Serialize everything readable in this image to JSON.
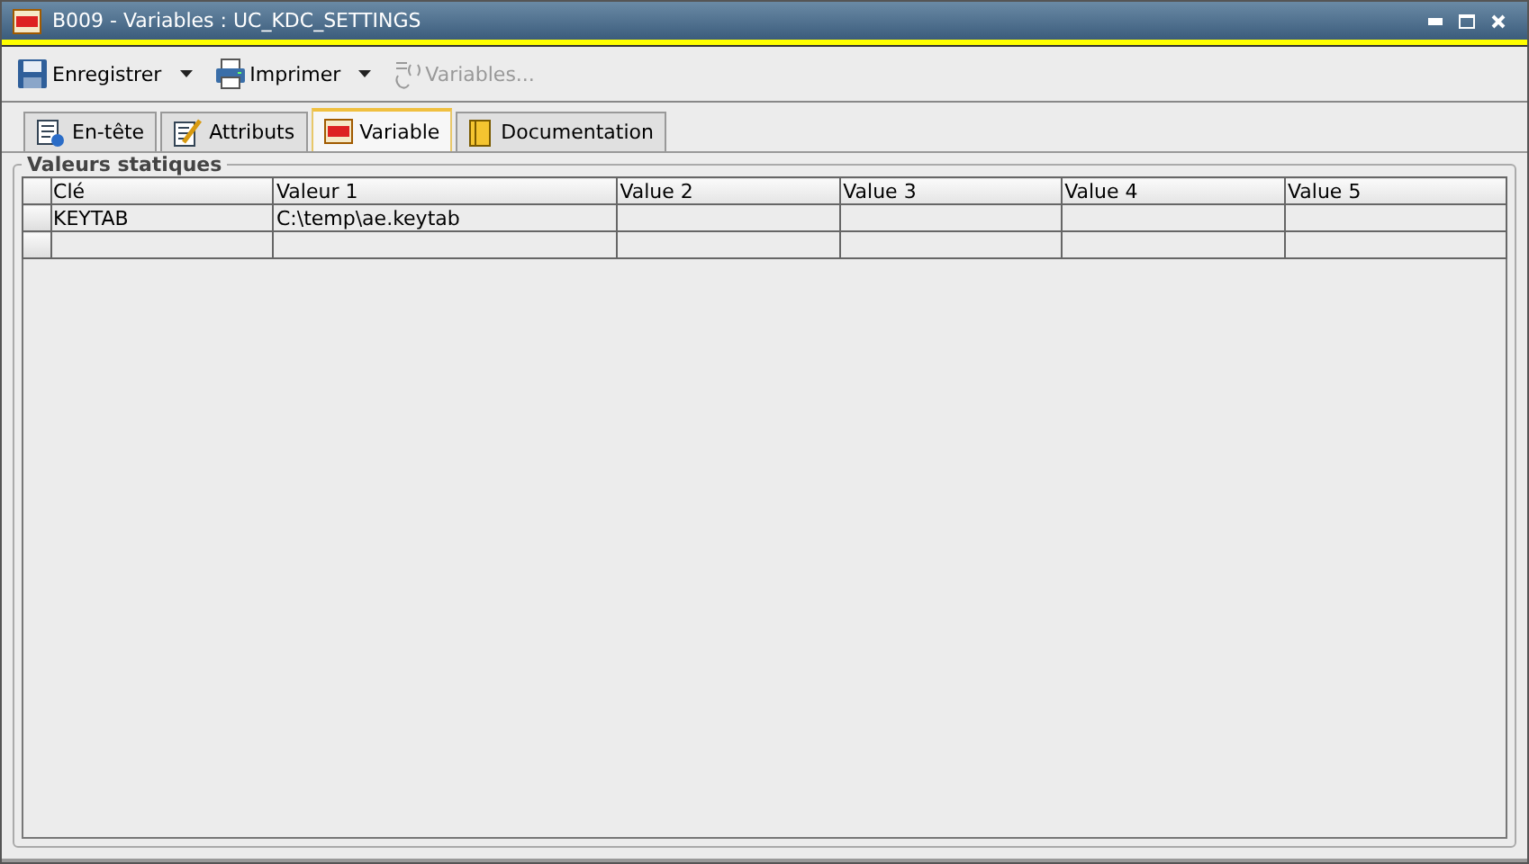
{
  "window": {
    "title": "B009 - Variables : UC_KDC_SETTINGS"
  },
  "toolbar": [
    {
      "kind": "save",
      "label": "Enregistrer",
      "dropdown": true,
      "disabled": false
    },
    {
      "kind": "print",
      "label": "Imprimer",
      "dropdown": true,
      "disabled": false
    },
    {
      "kind": "variables",
      "label": "Variables...",
      "dropdown": false,
      "disabled": true
    }
  ],
  "tabs": [
    {
      "kind": "header",
      "label": "En-tête",
      "selected": false
    },
    {
      "kind": "attributes",
      "label": "Attributs",
      "selected": false
    },
    {
      "kind": "variable",
      "label": "Variable",
      "selected": true
    },
    {
      "kind": "docs",
      "label": "Documentation",
      "selected": false
    }
  ],
  "group": {
    "title": "Valeurs statiques"
  },
  "table": {
    "columns": [
      "Clé",
      "Valeur 1",
      "Value 2",
      "Value 3",
      "Value 4",
      "Value 5"
    ],
    "rows": [
      [
        "KEYTAB",
        "C:\\temp\\ae.keytab",
        "",
        "",
        "",
        ""
      ],
      [
        "",
        "",
        "",
        "",
        "",
        ""
      ]
    ]
  }
}
